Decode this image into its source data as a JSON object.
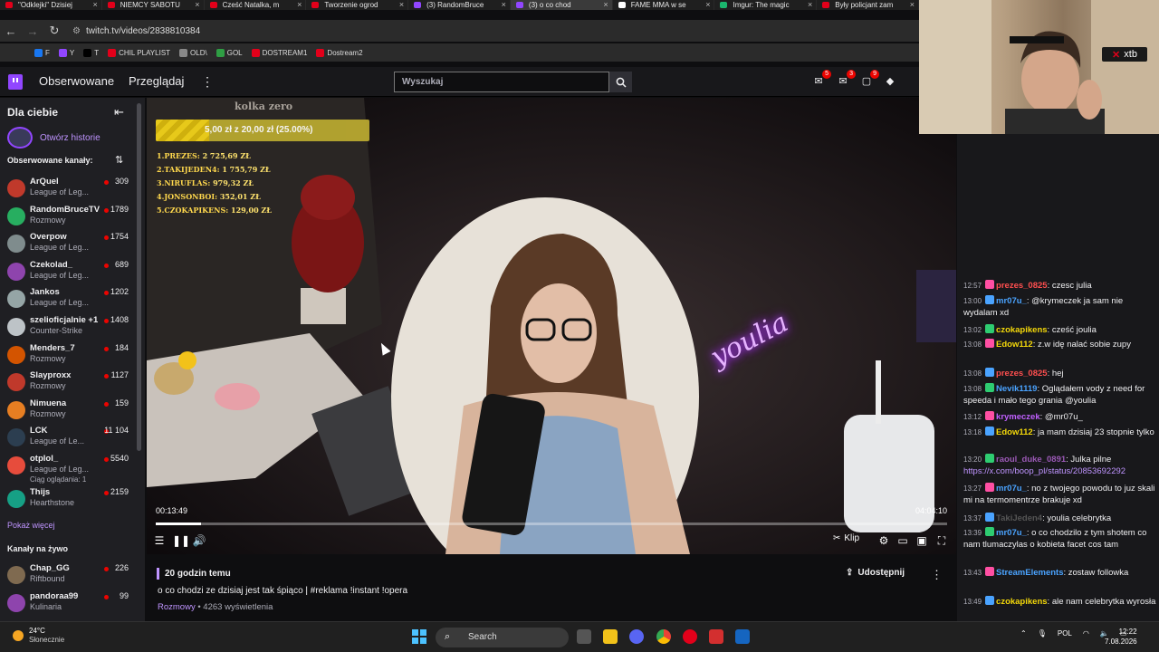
{
  "browser": {
    "tabs": [
      {
        "title": "\"Odklejki\" Dzisiej",
        "color": "#e2001a"
      },
      {
        "title": "NIEMCY SABOTU",
        "color": "#e2001a"
      },
      {
        "title": "Cześć Natalka, m",
        "color": "#e2001a"
      },
      {
        "title": "Tworzenie ogrod",
        "color": "#e2001a"
      },
      {
        "title": "(3) RandomBruce",
        "color": "#9146ff"
      },
      {
        "title": "(3) o co chod",
        "color": "#9146ff"
      },
      {
        "title": "FAME MMA w se",
        "color": "#ffffff"
      },
      {
        "title": "Imgur: The magic",
        "color": "#1bb76e"
      },
      {
        "title": "Były policjant zam",
        "color": "#e2001a"
      }
    ],
    "url": "twitch.tv/videos/2838810384",
    "bookmarks": [
      {
        "label": "F",
        "color": "#1877f2"
      },
      {
        "label": "Y",
        "color": "#9146ff"
      },
      {
        "label": "T",
        "color": "#000000"
      },
      {
        "label": "CHIL PLAYLIST",
        "color": "#e2001a"
      },
      {
        "label": "OLD\\",
        "color": "#888888"
      },
      {
        "label": "GOL",
        "color": "#2f9e44"
      },
      {
        "label": "DOSTREAM1",
        "color": "#e2001a"
      },
      {
        "label": "Dostream2",
        "color": "#e2001a"
      }
    ]
  },
  "topnav": {
    "following": "Obserwowane",
    "browse": "Przeglądaj",
    "search_placeholder": "Wyszukaj",
    "badges": [
      "5",
      "3",
      "9"
    ]
  },
  "sidebar": {
    "for_you": "Dla ciebie",
    "history": "Otwórz historie",
    "followed_header": "Obserwowane kanały:",
    "channels": [
      {
        "name": "ArQuel",
        "game": "League of Leg...",
        "viewers": "309",
        "color": "#c0392b"
      },
      {
        "name": "RandomBruceTV",
        "game": "Rozmowy",
        "viewers": "1789",
        "color": "#27ae60"
      },
      {
        "name": "Overpow",
        "game": "League of Leg...",
        "viewers": "1754",
        "color": "#7f8c8d"
      },
      {
        "name": "Czekolad_",
        "game": "League of Leg...",
        "viewers": "689",
        "color": "#8e44ad"
      },
      {
        "name": "Jankos",
        "game": "League of Leg...",
        "viewers": "1202",
        "color": "#95a5a6"
      },
      {
        "name": "szelioficjalnie +1",
        "game": "Counter-Strike",
        "viewers": "1408",
        "color": "#bdc3c7"
      },
      {
        "name": "Menders_7",
        "game": "Rozmowy",
        "viewers": "184",
        "color": "#d35400"
      },
      {
        "name": "Slayproxx",
        "game": "Rozmowy",
        "viewers": "1127",
        "color": "#c0392b"
      },
      {
        "name": "Nimuena",
        "game": "Rozmowy",
        "viewers": "159",
        "color": "#e67e22"
      },
      {
        "name": "LCK",
        "game": "League of Le...",
        "viewers": "11 104",
        "color": "#2c3e50"
      },
      {
        "name": "otplol_",
        "game": "League of Leg...",
        "viewers": "5540",
        "color": "#e74c3c",
        "extra": "Ciąg oglądania: 1"
      },
      {
        "name": "Thijs",
        "game": "Hearthstone",
        "viewers": "2159",
        "color": "#16a085"
      }
    ],
    "show_more": "Pokaż więcej",
    "live_header": "Kanały na żywo",
    "live_channels": [
      {
        "name": "Chap_GG",
        "game": "Riftbound",
        "viewers": "226",
        "color": "#7f6a50"
      },
      {
        "name": "pandoraa99",
        "game": "Kulinaria",
        "viewers": "99",
        "color": "#8e44ad"
      }
    ]
  },
  "video": {
    "overlay_title": "kolka zero",
    "goal_text": "5,00 zł z 20,00 zł (25.00%)",
    "goal_progress": 0.25,
    "top_donors": [
      {
        "label": "1.PREZES:",
        "value": "2 725,69 ZŁ"
      },
      {
        "label": "2.TAKIJEDEN4:",
        "value": "1 755,79 ZŁ"
      },
      {
        "label": "3.NIRUFLAS:",
        "value": "979,32 ZŁ"
      },
      {
        "label": "4.JONSONBOI:",
        "value": "352,01 ZŁ"
      },
      {
        "label": "5.CZOKAPIKENS:",
        "value": "129,00 ZŁ"
      }
    ],
    "neon_text": "youlia",
    "time_current": "00:13:49",
    "time_total": "04:04:10",
    "played_fraction": 0.057,
    "clip_label": "Klip"
  },
  "info": {
    "ago": "20 godzin temu",
    "title": "o co chodzi ze dzisiaj jest tak śpiąco | #reklama !instant !opera",
    "category": "Rozmowy",
    "views": " • 4263 wyświetlenia",
    "share": "Udostępnij"
  },
  "webcam": {
    "sponsor": "xtb"
  },
  "chat": {
    "messages": [
      {
        "ts": "12:57",
        "user": "prezes_0825",
        "ucolor": "#ff4f4f",
        "text": "czesc julia"
      },
      {
        "ts": "13:00",
        "user": "mr07u_",
        "ucolor": "#4aa3ff",
        "text": "@krymeczek ja sam nie wydalam xd"
      },
      {
        "ts": "13:02",
        "user": "czokapikens",
        "ucolor": "#f5d90a",
        "text": "cześć joulia"
      },
      {
        "ts": "13:08",
        "user": "Edow112",
        "ucolor": "#f5d90a",
        "text": "z.w idę nalać sobie zupy"
      },
      {
        "ts": "13:08",
        "user": "prezes_0825",
        "ucolor": "#ff4f4f",
        "text": "hej"
      },
      {
        "ts": "13:08",
        "user": "Nevik1119",
        "ucolor": "#4aa3ff",
        "text": "Oglądałem vody z need for speeda i mało tego grania @youlia"
      },
      {
        "ts": "13:12",
        "user": "krymeczek",
        "ucolor": "#c060ff",
        "text": "@mr07u_"
      },
      {
        "ts": "13:18",
        "user": "Edow112",
        "ucolor": "#f5d90a",
        "text": "ja mam dzisiaj 23 stopnie tylko"
      },
      {
        "ts": "13:20",
        "user": "raoul_duke_0891",
        "ucolor": "#9b59b6",
        "text": "Julka pilne",
        "link": "https://x.com/boop_pl/status/20853692292"
      },
      {
        "ts": "13:27",
        "user": "mr07u_",
        "ucolor": "#4aa3ff",
        "text": "no z twojego powodu to juz skali mi na termomentrze brakuje xd"
      },
      {
        "ts": "13:37",
        "user": "TakiJeden4",
        "ucolor": "#555555",
        "text": "youlia celebrytka"
      },
      {
        "ts": "13:39",
        "user": "mr07u_",
        "ucolor": "#4aa3ff",
        "text": "o co chodzilo z tym shotem co nam tlumaczylas o kobieta facet cos tam"
      },
      {
        "ts": "13:43",
        "user": "StreamElements",
        "ucolor": "#4aa3ff",
        "text": "zostaw followka"
      },
      {
        "ts": "13:49",
        "user": "czokapikens",
        "ucolor": "#f5d90a",
        "text": "ale nam celebrytka wyrosła"
      }
    ]
  },
  "taskbar": {
    "temp": "24°C",
    "weather": "Słonecznie",
    "search": "Search",
    "lang": "POL",
    "time": "12:22",
    "date": "7.08.2026"
  }
}
